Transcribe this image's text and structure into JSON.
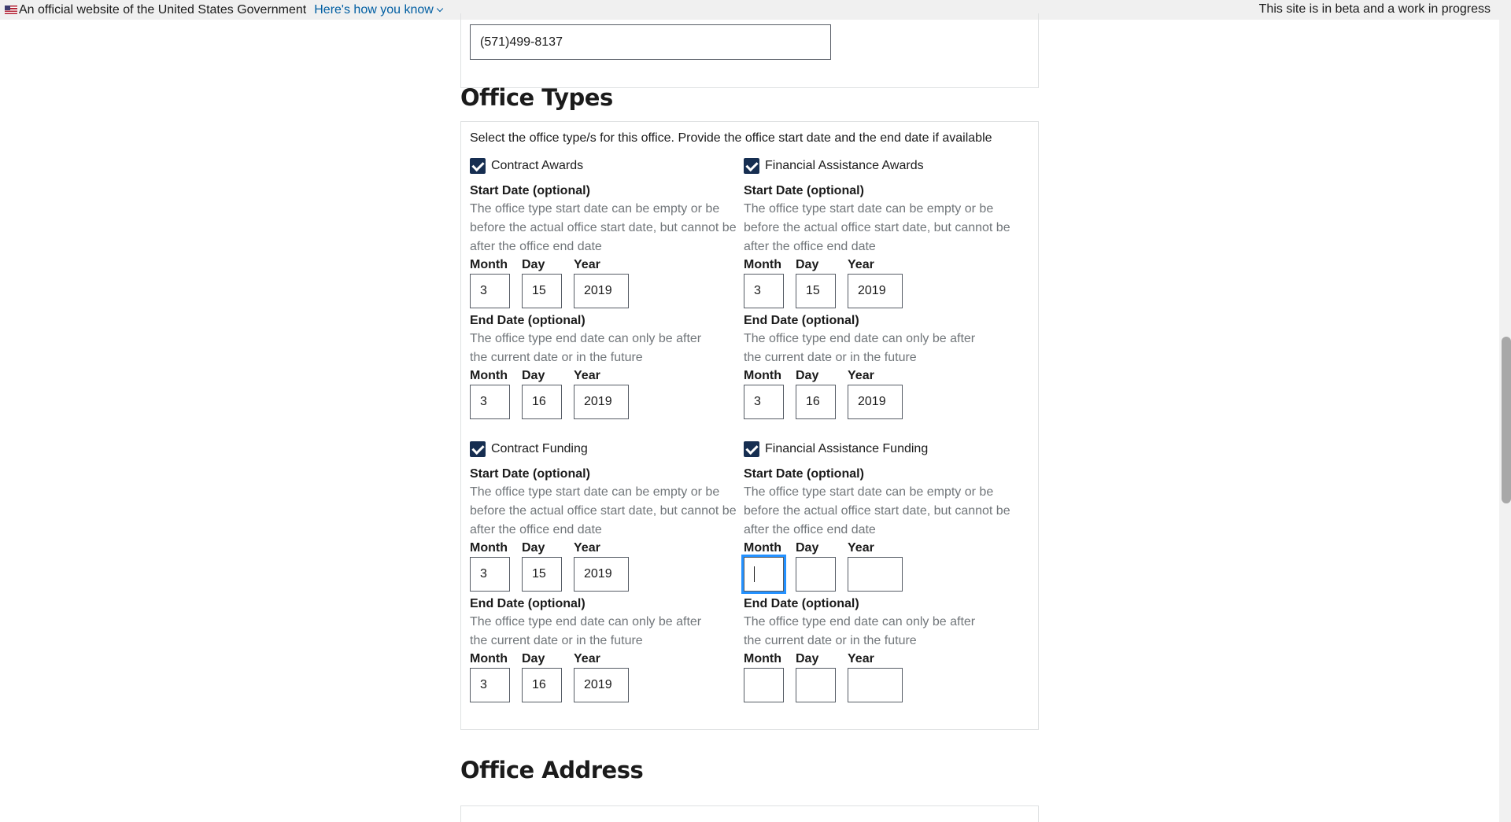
{
  "banner": {
    "official_text": "An official website of the United States Government",
    "how_link": "Here's how you know",
    "beta_text": "This site is in beta and a work in progress"
  },
  "phone": {
    "value": "(571)499-8137"
  },
  "office_types": {
    "title": "Office Types",
    "instructions": "Select the office type/s for this office. Provide the office start date and the end date if available",
    "types": [
      {
        "label": "Contract Awards",
        "checked": true,
        "start_label": "Start Date (optional)",
        "start_hint": "The office type start date can be empty or be before the actual office start date, but cannot be after the office end date",
        "start": {
          "month": "3",
          "day": "15",
          "year": "2019"
        },
        "end_label": "End Date (optional)",
        "end_hint": "The office type end date can only be after the current date or in the future",
        "end": {
          "month": "3",
          "day": "16",
          "year": "2019"
        }
      },
      {
        "label": "Financial Assistance Awards",
        "checked": true,
        "start_label": "Start Date (optional)",
        "start_hint": "The office type start date can be empty or be before the actual office start date, but cannot be after the office end date",
        "start": {
          "month": "3",
          "day": "15",
          "year": "2019"
        },
        "end_label": "End Date (optional)",
        "end_hint": "The office type end date can only be after the current date or in the future",
        "end": {
          "month": "3",
          "day": "16",
          "year": "2019"
        }
      },
      {
        "label": "Contract Funding",
        "checked": true,
        "start_label": "Start Date (optional)",
        "start_hint": "The office type start date can be empty or be before the actual office start date, but cannot be after the office end date",
        "start": {
          "month": "3",
          "day": "15",
          "year": "2019"
        },
        "end_label": "End Date (optional)",
        "end_hint": "The office type end date can only be after the current date or in the future",
        "end": {
          "month": "3",
          "day": "16",
          "year": "2019"
        }
      },
      {
        "label": "Financial Assistance Funding",
        "checked": true,
        "start_label": "Start Date (optional)",
        "start_hint": "The office type start date can be empty or be before the actual office start date, but cannot be after the office end date",
        "start": {
          "month": "",
          "day": "",
          "year": ""
        },
        "end_label": "End Date (optional)",
        "end_hint": "The office type end date can only be after the current date or in the future",
        "end": {
          "month": "",
          "day": "",
          "year": ""
        }
      }
    ],
    "field_labels": {
      "month": "Month",
      "day": "Day",
      "year": "Year"
    }
  },
  "office_address": {
    "title": "Office Address"
  },
  "colors": {
    "checkbox": "#162e51",
    "link": "#005ea2",
    "focus": "#2491ff",
    "hint": "#71767a"
  }
}
